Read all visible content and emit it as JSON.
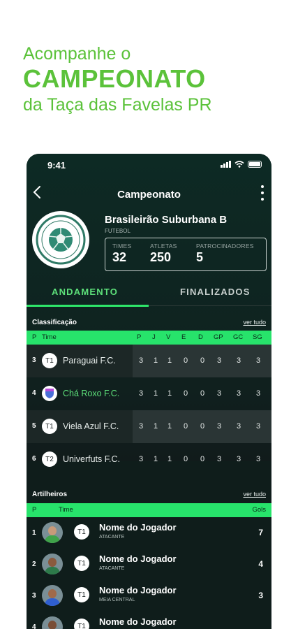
{
  "promo": {
    "line1": "Acompanhe o",
    "line2": "CAMPEONATO",
    "line3": "da Taça das Favelas PR"
  },
  "status_bar": {
    "time": "9:41"
  },
  "nav": {
    "title": "Campeonato"
  },
  "championship": {
    "name": "Brasileirão Suburbana B",
    "sport": "FUTEBOL",
    "stats": [
      {
        "label": "TIMES",
        "value": "32"
      },
      {
        "label": "ATLETAS",
        "value": "250"
      },
      {
        "label": "PATROCINADORES",
        "value": "5"
      }
    ]
  },
  "tabs": {
    "active": "ANDAMENTO",
    "inactive": "FINALIZADOS"
  },
  "classification": {
    "title": "Classificação",
    "link": "ver tudo",
    "headers": [
      "P",
      "Time",
      "P",
      "J",
      "V",
      "E",
      "D",
      "GP",
      "GC",
      "SG"
    ],
    "rows": [
      {
        "pos": "3",
        "badge": "T1",
        "team": "Paraguai F.C.",
        "stats": [
          "3",
          "1",
          "1",
          "0",
          "0",
          "3",
          "3",
          "3"
        ]
      },
      {
        "pos": "4",
        "badge": "",
        "team": "Chá Roxo F.C.",
        "stats": [
          "3",
          "1",
          "1",
          "0",
          "0",
          "3",
          "3",
          "3"
        ]
      },
      {
        "pos": "5",
        "badge": "T1",
        "team": "Viela Azul F.C.",
        "stats": [
          "3",
          "1",
          "1",
          "0",
          "0",
          "3",
          "3",
          "3"
        ]
      },
      {
        "pos": "6",
        "badge": "T2",
        "team": "Univerfuts F.C.",
        "stats": [
          "3",
          "1",
          "1",
          "0",
          "0",
          "3",
          "3",
          "3"
        ]
      }
    ]
  },
  "scorers": {
    "title": "Artilheiros",
    "link": "ver tudo",
    "headers": {
      "pos": "P",
      "team": "Time",
      "goals": "Gols"
    },
    "rows": [
      {
        "pos": "1",
        "badge": "T1",
        "name": "Nome do Jogador",
        "role": "ATACANTE",
        "goals": "7"
      },
      {
        "pos": "2",
        "badge": "T1",
        "name": "Nome do Jogador",
        "role": "ATACANTE",
        "goals": "4"
      },
      {
        "pos": "3",
        "badge": "T1",
        "name": "Nome do Jogador",
        "role": "MEIA CENTRAL",
        "goals": "3"
      },
      {
        "pos": "4",
        "badge": "T1",
        "name": "Nome do Jogador",
        "role": "",
        "goals": ""
      }
    ]
  },
  "colors": {
    "accent": "#5bc23a",
    "table_header": "#27e36b",
    "tab_active": "#5de07a"
  }
}
